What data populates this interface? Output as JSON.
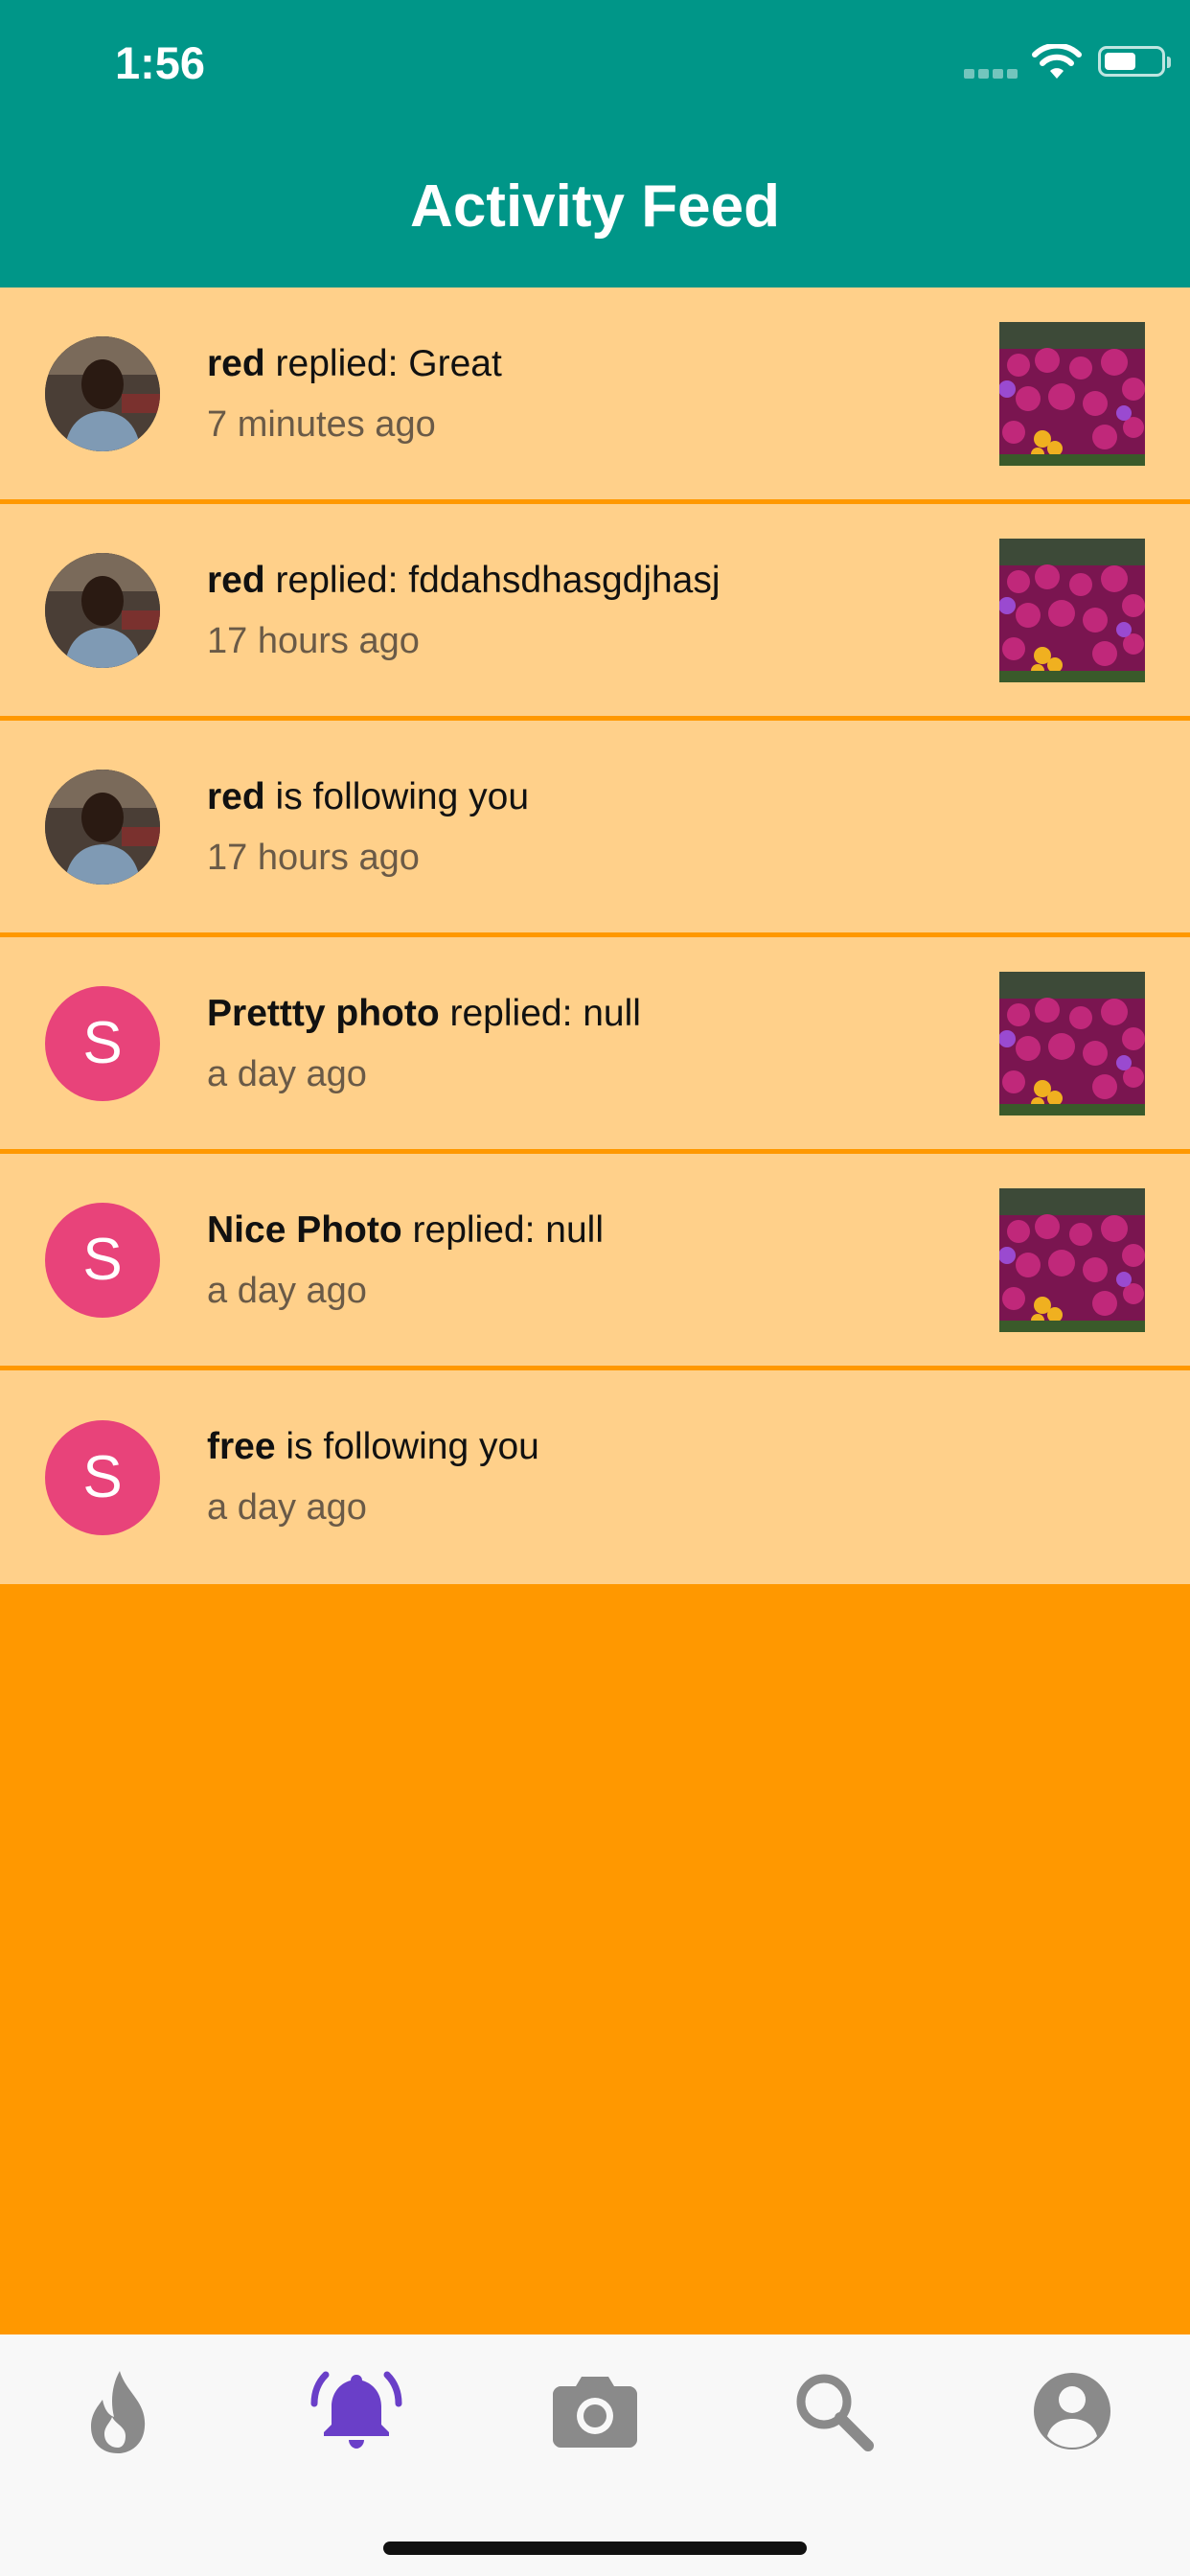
{
  "status_bar": {
    "time": "1:56"
  },
  "header": {
    "title": "Activity Feed"
  },
  "feed": [
    {
      "name": "red",
      "action": " replied: Great",
      "time": "7 minutes ago",
      "avatar": "photo",
      "thumbnail": true
    },
    {
      "name": "red",
      "action": " replied: fddahsdhasgdjhasj",
      "time": "17 hours ago",
      "avatar": "photo",
      "thumbnail": true
    },
    {
      "name": "red",
      "action": " is following you",
      "time": "17 hours ago",
      "avatar": "photo",
      "thumbnail": false
    },
    {
      "name": "Prettty photo",
      "action": " replied: null",
      "time": "a day ago",
      "avatar": "S",
      "thumbnail": true
    },
    {
      "name": "Nice Photo",
      "action": " replied: null",
      "time": "a day ago",
      "avatar": "S",
      "thumbnail": true
    },
    {
      "name": "free",
      "action": " is following you",
      "time": "a day ago",
      "avatar": "S",
      "thumbnail": false
    }
  ],
  "tabs": [
    {
      "icon": "fire-icon",
      "active": false
    },
    {
      "icon": "bell-icon",
      "active": true
    },
    {
      "icon": "camera-icon",
      "active": false
    },
    {
      "icon": "search-icon",
      "active": false
    },
    {
      "icon": "account-icon",
      "active": false
    }
  ],
  "colors": {
    "header": "#009688",
    "row_background": "#FFD08A",
    "page_background": "#FF9800",
    "avatar_letter_bg": "#E8437A",
    "active_tab": "#6A3FC8",
    "inactive_tab": "#8A8A8A"
  }
}
